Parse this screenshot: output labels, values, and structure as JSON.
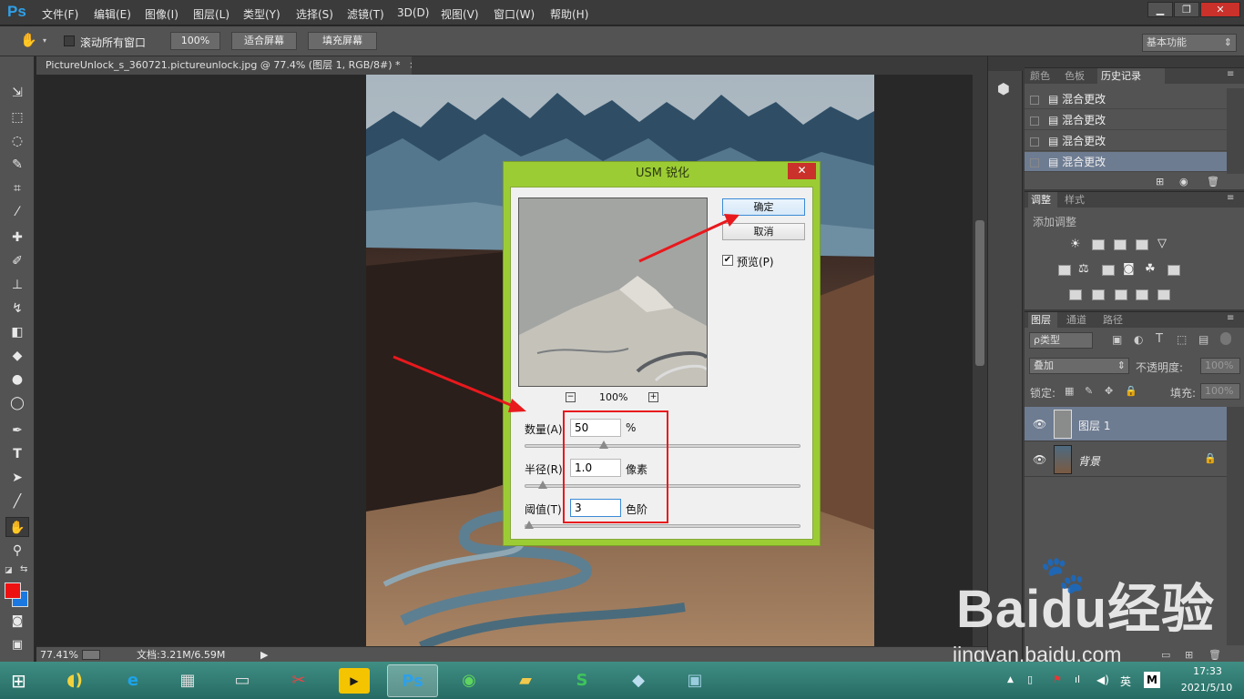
{
  "app": {
    "logo": "Ps"
  },
  "menu": [
    "文件(F)",
    "编辑(E)",
    "图像(I)",
    "图层(L)",
    "类型(Y)",
    "选择(S)",
    "滤镜(T)",
    "3D(D)",
    "视图(V)",
    "窗口(W)",
    "帮助(H)"
  ],
  "window_controls": {
    "minimize": "▁",
    "restore": "❐",
    "close": "✕"
  },
  "options": {
    "scroll_all_label": "滚动所有窗口",
    "zoom_value": "100%",
    "fit_screen": "适合屏幕",
    "fill_screen": "填充屏幕",
    "workspace": "基本功能"
  },
  "document_tab": {
    "title": "PictureUnlock_s_360721.pictureunlock.jpg @ 77.4% (图层 1, RGB/8#) *",
    "close": "×"
  },
  "dialog": {
    "title": "USM 锐化",
    "close": "✕",
    "ok": "确定",
    "cancel": "取消",
    "preview_label": "预览(P)",
    "preview_checked": true,
    "preview_zoom": "100%",
    "zoom_out": "−",
    "zoom_in": "+",
    "amount_label": "数量(A)",
    "amount_value": "50",
    "amount_unit": "%",
    "radius_label": "半径(R)",
    "radius_value": "1.0",
    "radius_unit": "像素",
    "threshold_label": "阈值(T)",
    "threshold_value": "3",
    "threshold_unit": "色阶",
    "amount_slider_fraction": 0.27,
    "radius_slider_fraction": 0.05,
    "threshold_slider_fraction": 0.0
  },
  "history_panel": {
    "tabs": [
      "颜色",
      "色板",
      "历史记录"
    ],
    "active_tab": "历史记录",
    "items": [
      "混合更改",
      "混合更改",
      "混合更改",
      "混合更改"
    ]
  },
  "adjustments_panel": {
    "tabs": [
      "调整",
      "样式"
    ],
    "add_label": "添加调整"
  },
  "layers_panel": {
    "tabs": [
      "图层",
      "通道",
      "路径"
    ],
    "filter_label": "ρ类型",
    "blend_mode": "叠加",
    "opacity_label": "不透明度:",
    "opacity_value": "100%",
    "lock_label": "锁定:",
    "fill_label": "填充:",
    "fill_value": "100%",
    "layers": [
      {
        "name": "图层 1",
        "selected": true
      },
      {
        "name": "背景",
        "selected": false,
        "locked": true
      }
    ]
  },
  "status_bar": {
    "zoom": "77.41%",
    "doc_info": "文档:3.21M/6.59M"
  },
  "taskbar": {
    "time": "17:33",
    "date": "2021/5/10",
    "ime": "英",
    "ime2": "M"
  },
  "watermark": {
    "brand": "Baidu经验",
    "url": "jingyan.baidu.com"
  },
  "colors": {
    "accent_green": "#9ccc34",
    "annotation_red": "#e8191d",
    "selection_blue": "#6e7c92"
  }
}
